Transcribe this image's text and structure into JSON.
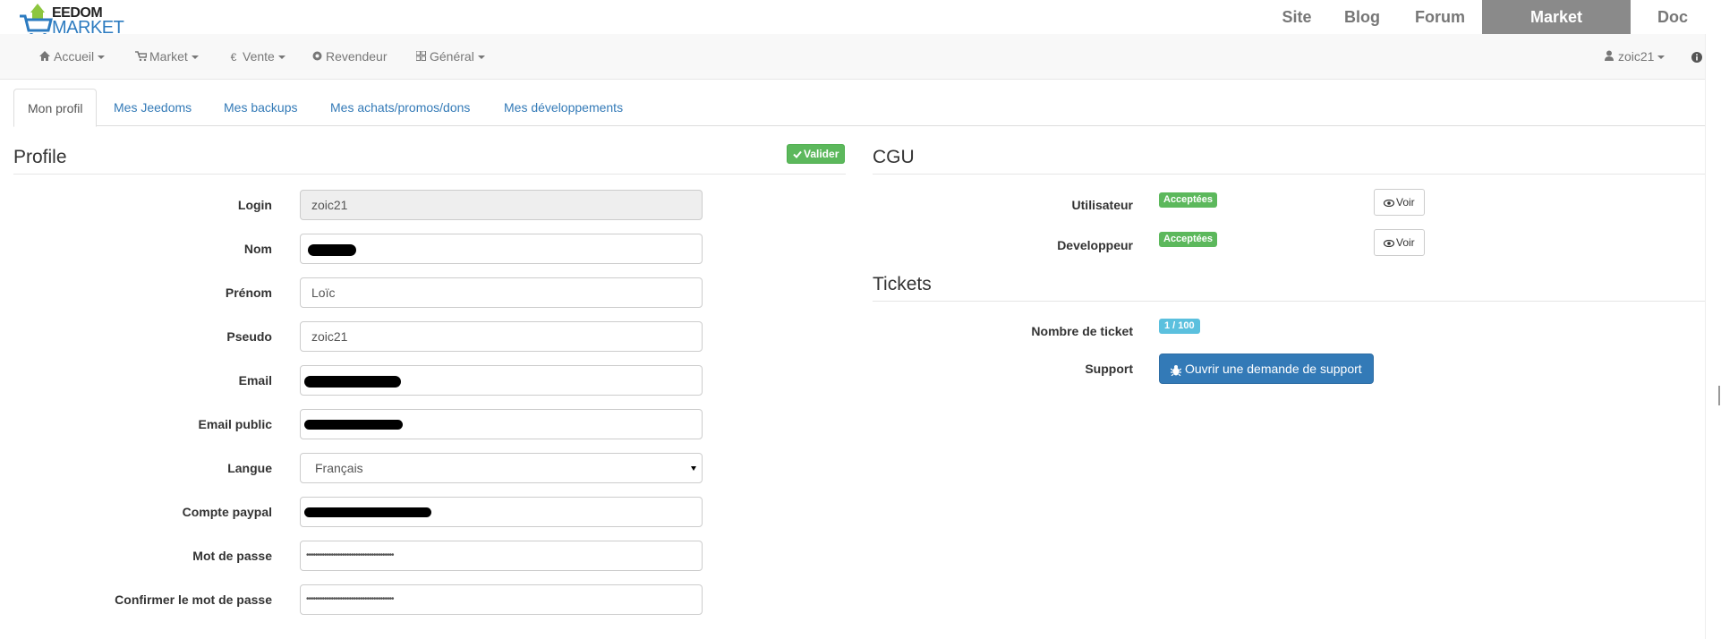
{
  "brand": {
    "line1": "EEDOM",
    "line2": "MARKET"
  },
  "topnav": {
    "site": "Site",
    "blog": "Blog",
    "forum": "Forum",
    "market": "Market",
    "doc": "Doc"
  },
  "navbar": {
    "accueil": "Accueil",
    "market": "Market",
    "vente": "Vente",
    "revendeur": "Revendeur",
    "general": "Général",
    "user": "zoic21",
    "euro_symbol": "€"
  },
  "tabs": {
    "profil": "Mon profil",
    "jeedoms": "Mes Jeedoms",
    "backups": "Mes backups",
    "achats": "Mes achats/promos/dons",
    "dev": "Mes développements"
  },
  "profile": {
    "title": "Profile",
    "save_label": "Valider",
    "labels": {
      "login": "Login",
      "nom": "Nom",
      "prenom": "Prénom",
      "pseudo": "Pseudo",
      "email": "Email",
      "email_public": "Email public",
      "langue": "Langue",
      "paypal": "Compte paypal",
      "password": "Mot de passe",
      "password_confirm": "Confirmer le mot de passe"
    },
    "values": {
      "login": "zoic21",
      "prenom": "Loïc",
      "pseudo": "zoic21",
      "langue": "Français",
      "password": "•••••••••••••••••••••••••••••••••••••••",
      "password_confirm": "•••••••••••••••••••••••••••••••••••••••"
    }
  },
  "cgu": {
    "title": "CGU",
    "utilisateur_label": "Utilisateur",
    "developpeur_label": "Developpeur",
    "status": "Acceptées",
    "voir_label": "Voir"
  },
  "tickets": {
    "title": "Tickets",
    "count_label": "Nombre de ticket",
    "count_value": "1 / 100",
    "support_label": "Support",
    "support_button": "Ouvrir une demande de support"
  },
  "colors": {
    "primary": "#337ab7",
    "success": "#5cb85c",
    "info": "#5bc0de",
    "active_tab_bg": "#8a8a8a"
  },
  "icons": [
    "home-icon",
    "cart-icon",
    "euro-icon",
    "certificate-icon",
    "grid-icon",
    "user-icon",
    "info-icon",
    "check-icon",
    "eye-icon",
    "bug-icon"
  ]
}
